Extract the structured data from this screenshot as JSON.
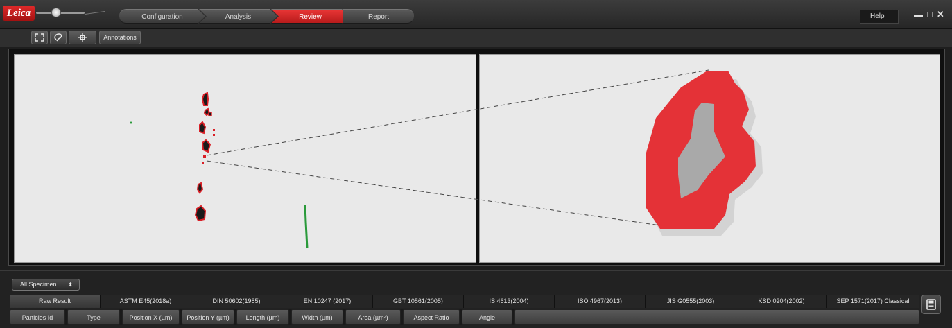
{
  "app": {
    "logo_text": "Leica"
  },
  "workflow": {
    "steps": [
      {
        "label": "Configuration",
        "active": false
      },
      {
        "label": "Analysis",
        "active": false
      },
      {
        "label": "Review",
        "active": true
      },
      {
        "label": "Report",
        "active": false
      }
    ]
  },
  "window": {
    "help_label": "Help",
    "minimize": "▬",
    "maximize": "□",
    "close": "✕"
  },
  "toolbar": {
    "annotations_label": "Annotations"
  },
  "results": {
    "specimen_select": {
      "value": "All Specimen"
    },
    "standard_tabs": [
      "Raw Result",
      "ASTM E45(2018a)",
      "DIN 50602(1985)",
      "EN 10247 (2017)",
      "GBT 10561(2005)",
      "IS 4613(2004)",
      "ISO 4967(2013)",
      "JIS G0555(2003)",
      "KSD 0204(2002)",
      "SEP 1571(2017) Classical"
    ],
    "active_standard_index": 0,
    "columns": [
      "Particles Id",
      "Type",
      "Position X (µm)",
      "Position Y (µm)",
      "Length (µm)",
      "Width (µm)",
      "Area (µm²)",
      "Aspect Ratio",
      "Angle"
    ]
  },
  "colors": {
    "accent_red": "#e23333",
    "particle_red": "#d91f26",
    "particle_fill": "#1a1a1a",
    "particle_green": "#2a9a3a",
    "zoom_particle_red": "#e43237",
    "zoom_particle_core": "#a9a9a9"
  }
}
